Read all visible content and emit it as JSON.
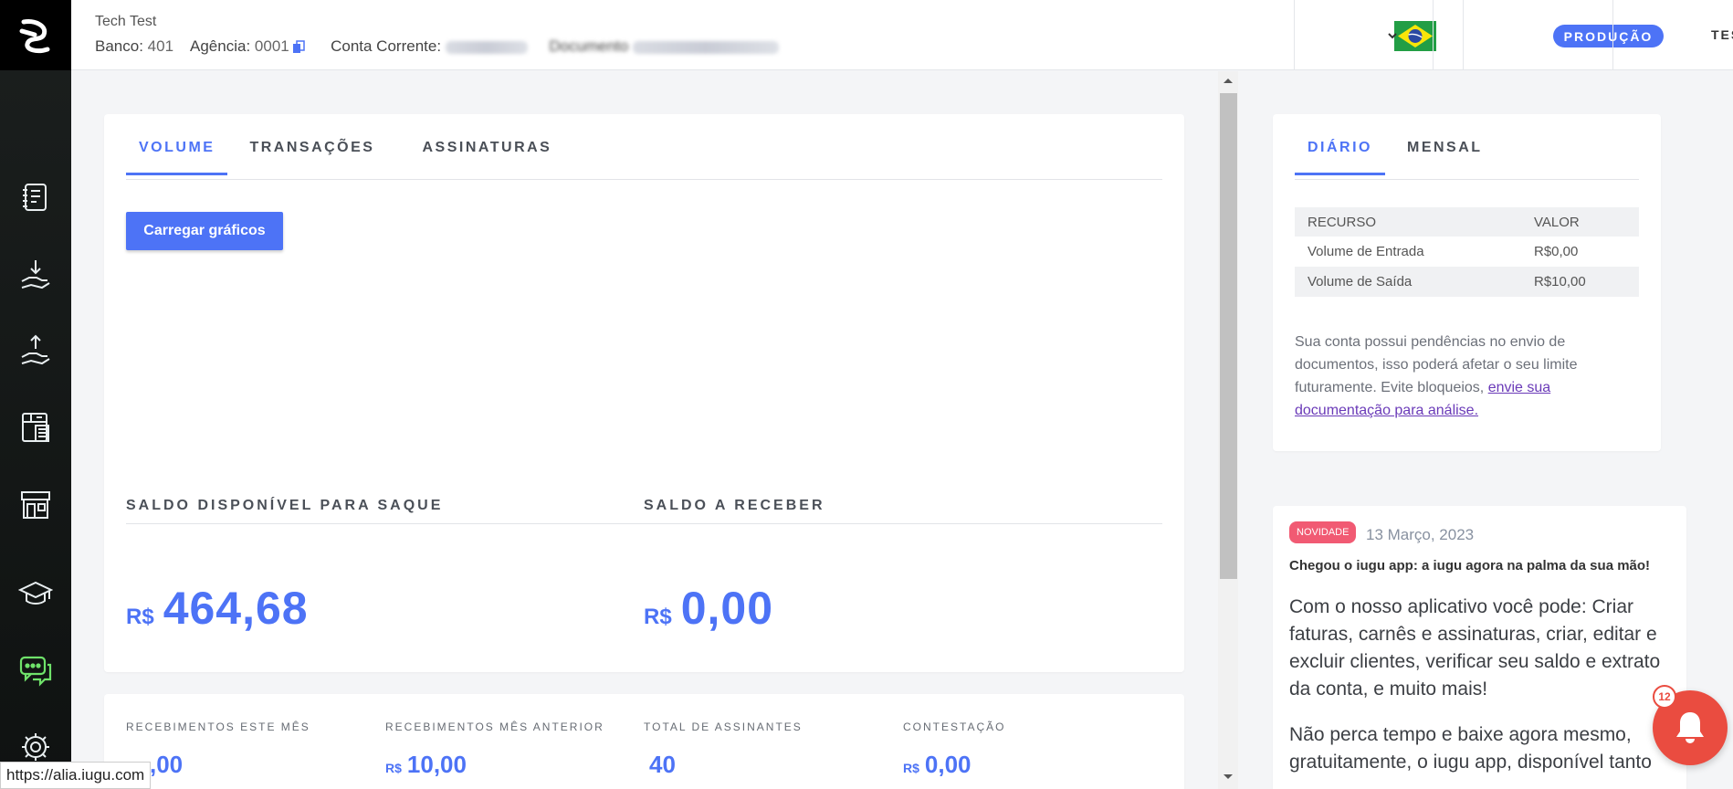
{
  "header": {
    "company": "Tech Test",
    "banco_label": "Banco:",
    "banco_value": "401",
    "agencia_label": "Agência:",
    "agencia_value": "0001",
    "conta_label": "Conta Corrente:",
    "documento_label": "Documento",
    "environment_badge": "PRODUÇÃO",
    "user": "TESTE"
  },
  "volume_card": {
    "tabs": [
      {
        "label": "VOLUME",
        "active": true
      },
      {
        "label": "TRANSAÇÕES",
        "active": false
      },
      {
        "label": "ASSINATURAS",
        "active": false
      }
    ],
    "load_button": "Carregar gráficos",
    "saldo_disponivel_label": "SALDO DISPONÍVEL PARA SAQUE",
    "saldo_disponivel_currency": "R$",
    "saldo_disponivel_value": "464,68",
    "saldo_receber_label": "SALDO A RECEBER",
    "saldo_receber_currency": "R$",
    "saldo_receber_value": "0,00"
  },
  "stats": [
    {
      "label": "RECEBIMENTOS ESTE MÊS",
      "currency": "",
      "value": ",00"
    },
    {
      "label": "RECEBIMENTOS MÊS ANTERIOR",
      "currency": "R$",
      "value": "10,00"
    },
    {
      "label": "TOTAL DE ASSINANTES",
      "currency": "",
      "value": "40"
    },
    {
      "label": "CONTESTAÇÃO",
      "currency": "R$",
      "value": "0,00"
    }
  ],
  "resources_card": {
    "tabs": [
      {
        "label": "DIÁRIO",
        "active": true
      },
      {
        "label": "MENSAL",
        "active": false
      }
    ],
    "table": {
      "headers": [
        "RECURSO",
        "VALOR"
      ],
      "rows": [
        [
          "Volume de Entrada",
          "R$0,00"
        ],
        [
          "Volume de Saída",
          "R$10,00"
        ]
      ]
    },
    "note_text": "Sua conta possui pendências no envio de documentos, isso poderá afetar o seu limite futuramente. Evite bloqueios,",
    "note_link": "envie sua documentação para análise."
  },
  "news": {
    "badge": "NOVIDADE",
    "date": "13 Março, 2023",
    "title": "Chegou o iugu app: a iugu agora na palma da sua mão!",
    "paragraph1": "Com o nosso aplicativo você pode: Criar faturas, carnês e assinaturas, criar, editar e excluir clientes, verificar seu saldo e extrato da conta, e muito mais!",
    "paragraph2": "Não perca tempo e baixe agora mesmo, gratuitamente, o iugu app, disponível tanto"
  },
  "notifications": {
    "count": "12"
  },
  "status_url": "https://alia.iugu.com",
  "colors": {
    "accent": "#4d73f6",
    "sidebar": "#121615",
    "badge_new": "#f15a73",
    "bell": "#ea4c40"
  },
  "icons": [
    "logo-icon",
    "ledger-icon",
    "receive-icon",
    "send-icon",
    "calculator-icon",
    "store-icon",
    "graduation-icon",
    "chat-icon",
    "gear-icon",
    "bell-icon",
    "brazil-flag-icon"
  ]
}
